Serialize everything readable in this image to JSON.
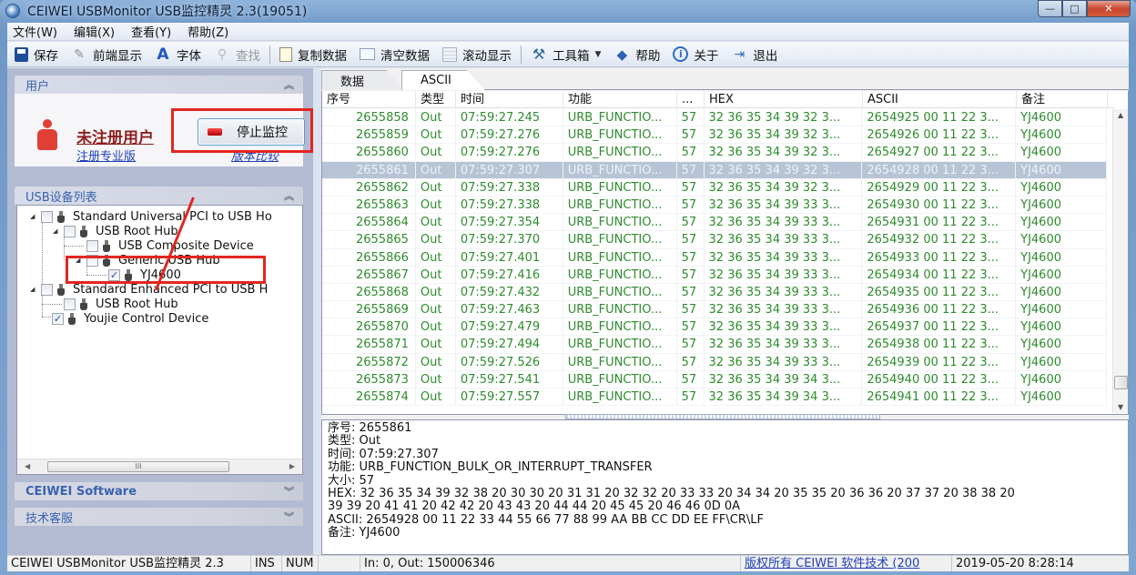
{
  "window": {
    "title": "CEIWEI USBMonitor USB监控精灵 2.3(19051)",
    "controls": {
      "minimize": "—",
      "maximize": "□",
      "close": "✕"
    }
  },
  "menu": [
    "文件(W)",
    "编辑(X)",
    "查看(Y)",
    "帮助(Z)"
  ],
  "toolbar": {
    "save": "保存",
    "front": "前端显示",
    "font": "字体",
    "find": "查找",
    "copy": "复制数据",
    "clear": "清空数据",
    "scroll": "滚动显示",
    "tools": "工具箱",
    "help": "帮助",
    "about": "关于",
    "exit": "退出"
  },
  "icons": {
    "font": "A",
    "tools": "⚒",
    "help": "◆",
    "about": "i",
    "exit": "⇥",
    "dropdown": "▼",
    "collapse": "︽",
    "expand": "︾",
    "tree_expanded": "◢",
    "checkmark": "✓",
    "scroll_left": "◀",
    "scroll_right": "▶",
    "scroll_up": "▲",
    "scroll_down": "▼",
    "grip": "III"
  },
  "user_panel": {
    "header": "用户",
    "user_name": "未注册用户",
    "register_link": "注册专业版",
    "version_link": "版本比较",
    "stop_button": "停止监控"
  },
  "device_panel": {
    "header": "USB设备列表",
    "tree": [
      {
        "label": "Standard Universal PCI to USB Ho",
        "level": 0,
        "checked": false,
        "expanded": true
      },
      {
        "label": "USB Root Hub",
        "level": 1,
        "checked": false,
        "expanded": true
      },
      {
        "label": "USB Composite Device",
        "level": 2,
        "checked": false
      },
      {
        "label": "Generic USB Hub",
        "level": 2,
        "checked": false,
        "expanded": true
      },
      {
        "label": "YJ4600",
        "level": 3,
        "checked": true
      },
      {
        "label": "Standard Enhanced PCI to USB H",
        "level": 0,
        "checked": false,
        "expanded": true
      },
      {
        "label": "USB Root Hub",
        "level": 1,
        "checked": false
      },
      {
        "label": "Youjie Control Device",
        "level": 0,
        "checked": true
      }
    ]
  },
  "collapsed_panels": [
    "CEIWEI Software",
    "技术客服"
  ],
  "tabs": [
    "数据",
    "ASCII"
  ],
  "active_tab": 1,
  "grid": {
    "columns": [
      "序号",
      "类型",
      "时间",
      "功能",
      "...",
      "HEX",
      "ASCII",
      "备注"
    ],
    "selected_index": 3,
    "rows": [
      [
        "2655858",
        "Out",
        "07:59:27.245",
        "URB_FUNCTIO...",
        "57",
        "32 36 35 34 39 32 3...",
        "2654925 00 11 22 3...",
        "YJ4600"
      ],
      [
        "2655859",
        "Out",
        "07:59:27.276",
        "URB_FUNCTIO...",
        "57",
        "32 36 35 34 39 32 3...",
        "2654926 00 11 22 3...",
        "YJ4600"
      ],
      [
        "2655860",
        "Out",
        "07:59:27.276",
        "URB_FUNCTIO...",
        "57",
        "32 36 35 34 39 32 3...",
        "2654927 00 11 22 3...",
        "YJ4600"
      ],
      [
        "2655861",
        "Out",
        "07:59:27.307",
        "URB_FUNCTIO...",
        "57",
        "32 36 35 34 39 32 3...",
        "2654928 00 11 22 3...",
        "YJ4600"
      ],
      [
        "2655862",
        "Out",
        "07:59:27.338",
        "URB_FUNCTIO...",
        "57",
        "32 36 35 34 39 32 3...",
        "2654929 00 11 22 3...",
        "YJ4600"
      ],
      [
        "2655863",
        "Out",
        "07:59:27.338",
        "URB_FUNCTIO...",
        "57",
        "32 36 35 34 39 33 3...",
        "2654930 00 11 22 3...",
        "YJ4600"
      ],
      [
        "2655864",
        "Out",
        "07:59:27.354",
        "URB_FUNCTIO...",
        "57",
        "32 36 35 34 39 33 3...",
        "2654931 00 11 22 3...",
        "YJ4600"
      ],
      [
        "2655865",
        "Out",
        "07:59:27.370",
        "URB_FUNCTIO...",
        "57",
        "32 36 35 34 39 33 3...",
        "2654932 00 11 22 3...",
        "YJ4600"
      ],
      [
        "2655866",
        "Out",
        "07:59:27.401",
        "URB_FUNCTIO...",
        "57",
        "32 36 35 34 39 33 3...",
        "2654933 00 11 22 3...",
        "YJ4600"
      ],
      [
        "2655867",
        "Out",
        "07:59:27.416",
        "URB_FUNCTIO...",
        "57",
        "32 36 35 34 39 33 3...",
        "2654934 00 11 22 3...",
        "YJ4600"
      ],
      [
        "2655868",
        "Out",
        "07:59:27.432",
        "URB_FUNCTIO...",
        "57",
        "32 36 35 34 39 33 3...",
        "2654935 00 11 22 3...",
        "YJ4600"
      ],
      [
        "2655869",
        "Out",
        "07:59:27.463",
        "URB_FUNCTIO...",
        "57",
        "32 36 35 34 39 33 3...",
        "2654936 00 11 22 3...",
        "YJ4600"
      ],
      [
        "2655870",
        "Out",
        "07:59:27.479",
        "URB_FUNCTIO...",
        "57",
        "32 36 35 34 39 33 3...",
        "2654937 00 11 22 3...",
        "YJ4600"
      ],
      [
        "2655871",
        "Out",
        "07:59:27.494",
        "URB_FUNCTIO...",
        "57",
        "32 36 35 34 39 33 3...",
        "2654938 00 11 22 3...",
        "YJ4600"
      ],
      [
        "2655872",
        "Out",
        "07:59:27.526",
        "URB_FUNCTIO...",
        "57",
        "32 36 35 34 39 33 3...",
        "2654939 00 11 22 3...",
        "YJ4600"
      ],
      [
        "2655873",
        "Out",
        "07:59:27.541",
        "URB_FUNCTIO...",
        "57",
        "32 36 35 34 39 34 3...",
        "2654940 00 11 22 3...",
        "YJ4600"
      ],
      [
        "2655874",
        "Out",
        "07:59:27.557",
        "URB_FUNCTIO...",
        "57",
        "32 36 35 34 39 34 3...",
        "2654941 00 11 22 3...",
        "YJ4600"
      ]
    ]
  },
  "detail": [
    "序号: 2655861",
    "类型: Out",
    "时间: 07:59:27.307",
    "功能: URB_FUNCTION_BULK_OR_INTERRUPT_TRANSFER",
    "大小: 57",
    "HEX: 32 36 35 34 39 32 38 20 30 30 20 31 31 20 32 32 20 33 33 20 34 34 20 35 35 20 36 36 20 37 37 20 38 38 20",
    "39 39 20 41 41 20 42 42 20 43 43 20 44 44 20 45 45 20 46 46 0D 0A",
    "ASCII: 2654928 00 11 22 33 44 55 66 77 88 99 AA BB CC DD EE FF\\CR\\LF",
    "备注: YJ4600"
  ],
  "statusbar": {
    "app": "CEIWEI USBMonitor USB监控精灵 2.3",
    "ins": "INS",
    "num": "NUM",
    "blank": "",
    "io": "In: 0, Out: 150006346",
    "copyright": "版权所有 CEIWEI 软件技术 (200",
    "datetime": "2019-05-20 8:28:14"
  },
  "colors": {
    "row_text": "#2e8b2e",
    "selection": "#b7c4d6",
    "highlight_box": "#e32620",
    "link": "#2040b8"
  }
}
